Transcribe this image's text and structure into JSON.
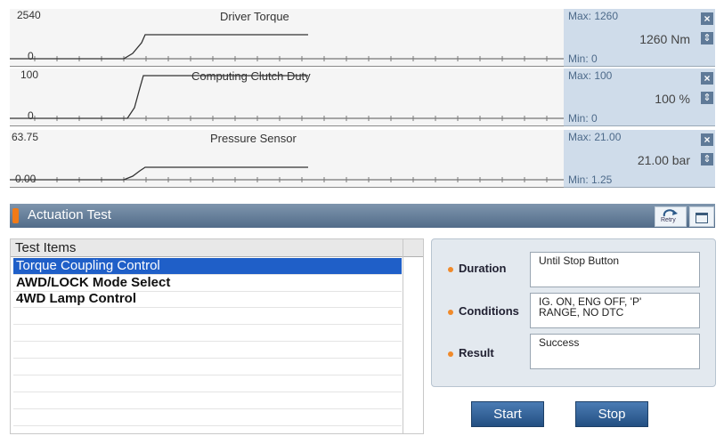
{
  "graphs": [
    {
      "title": "Driver Torque",
      "axis_max": "2540",
      "axis_min": "0",
      "side_max": "Max: 1260",
      "side_value": "1260 Nm",
      "side_min": "Min:  0"
    },
    {
      "title": "Computing Clutch Duty",
      "axis_max": "100",
      "axis_min": "0",
      "side_max": "Max: 100",
      "side_value": "100 %",
      "side_min": "Min:  0"
    },
    {
      "title": "Pressure Sensor",
      "axis_max": "63.75",
      "axis_min": "0.00",
      "side_max": "Max: 21.00",
      "side_value": "21.00 bar",
      "side_min": "Min:  1.25"
    }
  ],
  "icons": {
    "close": "close-icon",
    "scroll": "spin-arrows-icon",
    "retry": "refresh-icon",
    "window": "window-icon"
  },
  "actuation": {
    "title": "Actuation Test",
    "retry_label": "Retry"
  },
  "test_items": {
    "header": "Test Items",
    "rows": [
      "Torque Coupling Control",
      "AWD/LOCK Mode Select",
      "4WD Lamp Control"
    ],
    "selected_index": 0
  },
  "info": {
    "duration_label": "Duration",
    "duration_value": "Until Stop Button",
    "conditions_label": "Conditions",
    "conditions_value": "IG. ON, ENG OFF, 'P'\nRANGE, NO DTC",
    "result_label": "Result",
    "result_value": "Success"
  },
  "buttons": {
    "start": "Start",
    "stop": "Stop"
  },
  "colors": {
    "accent": "#f07a18",
    "selection": "#1f5fc8",
    "header": "#5f7a98"
  }
}
